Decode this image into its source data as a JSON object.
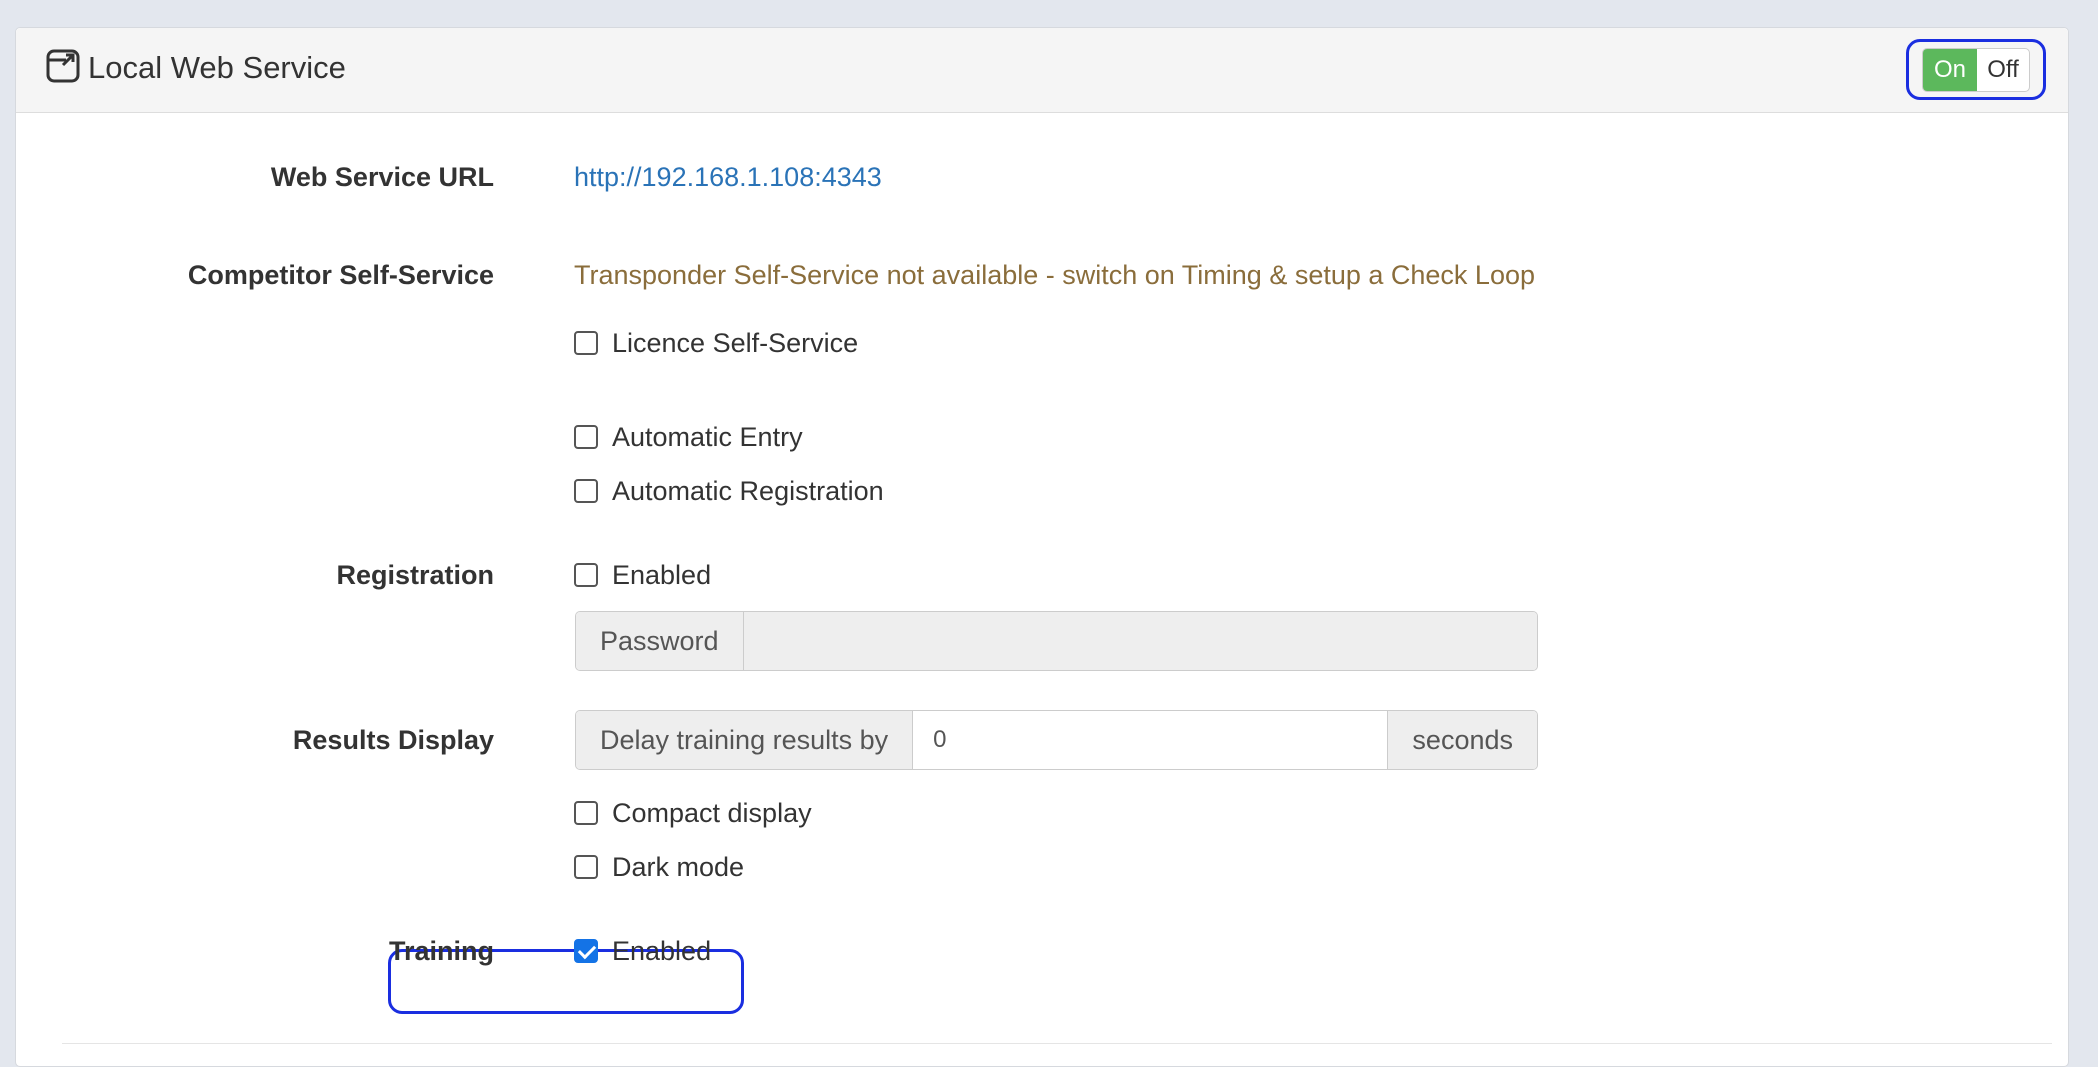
{
  "panel": {
    "title": "Local Web Service",
    "icon": "external-window-icon",
    "toggle": {
      "on_label": "On",
      "off_label": "Off",
      "state": "on",
      "on_color": "#5cb85c"
    }
  },
  "web_service_url": {
    "label": "Web Service URL",
    "value": "http://192.168.1.108:4343"
  },
  "competitor_self_service": {
    "label": "Competitor Self-Service",
    "warning": "Transponder Self-Service not available - switch on Timing & setup a Check Loop",
    "licence_label": "Licence Self-Service",
    "licence_checked": false,
    "automatic_entry_label": "Automatic Entry",
    "automatic_entry_checked": false,
    "automatic_registration_label": "Automatic Registration",
    "automatic_registration_checked": false
  },
  "registration": {
    "label": "Registration",
    "enabled_label": "Enabled",
    "enabled_checked": false,
    "password_label": "Password",
    "password_value": ""
  },
  "results_display": {
    "label": "Results Display",
    "delay_label": "Delay training results by",
    "delay_value": "0",
    "delay_unit": "seconds",
    "compact_label": "Compact display",
    "compact_checked": false,
    "dark_label": "Dark mode",
    "dark_checked": false
  },
  "training": {
    "label": "Training",
    "enabled_label": "Enabled",
    "enabled_checked": true
  },
  "colors": {
    "link": "#2a73b7",
    "warning": "#8a6d3b",
    "highlight": "#1a2ee0",
    "checkbox_checked": "#1473e6"
  }
}
